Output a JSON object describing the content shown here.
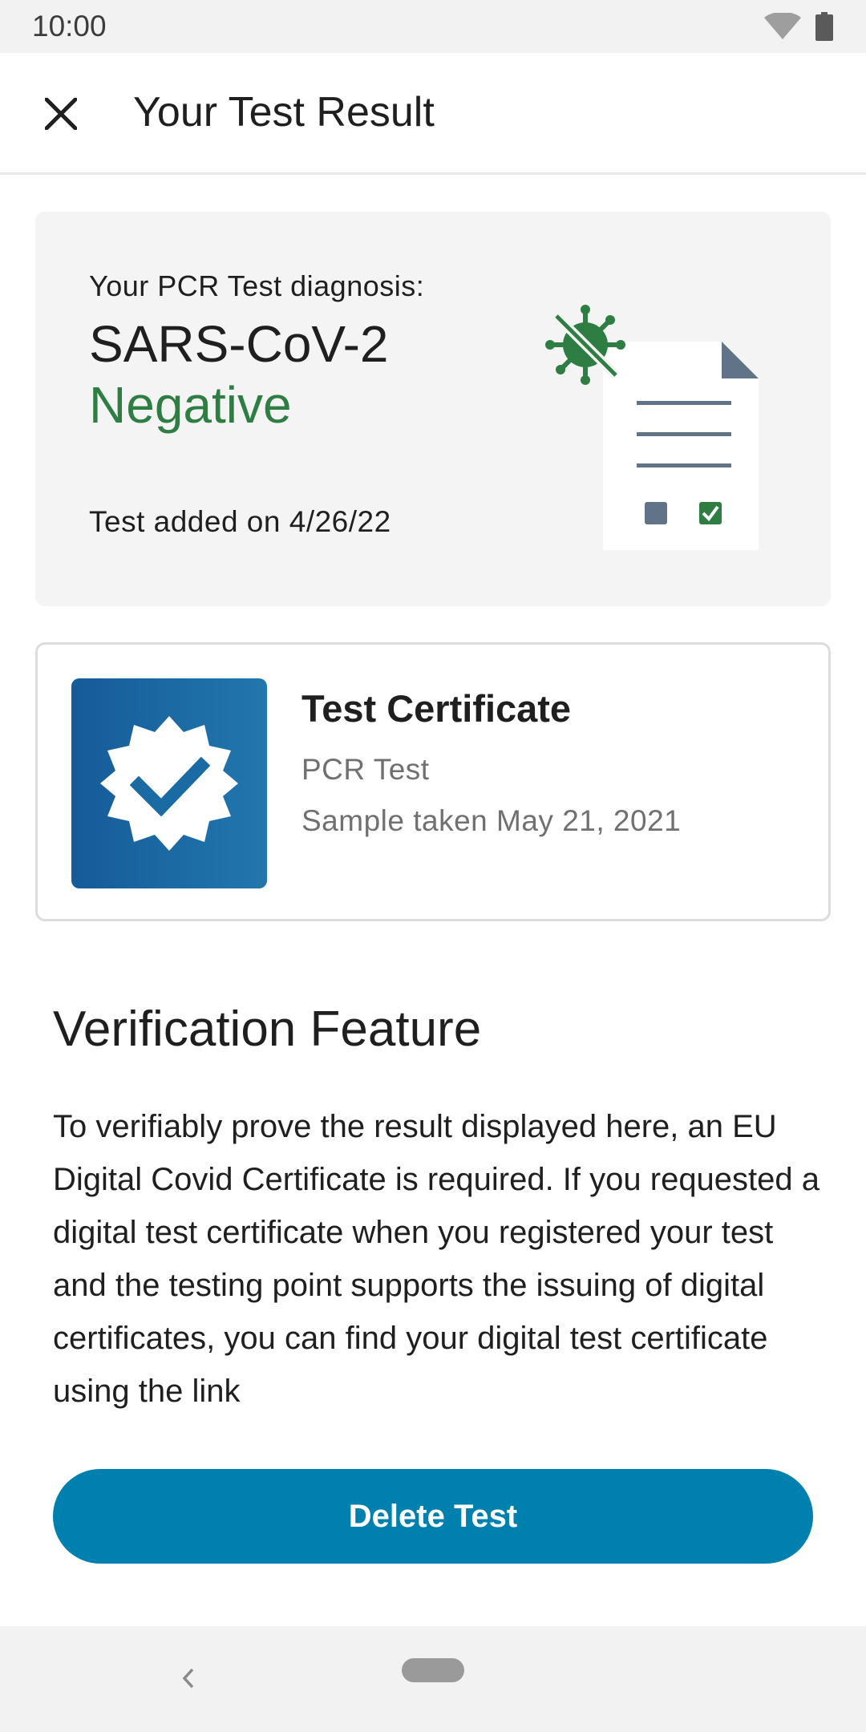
{
  "status_bar": {
    "time": "10:00",
    "icons": [
      "wifi-icon",
      "battery-icon"
    ]
  },
  "app_bar": {
    "title": "Your Test Result",
    "close_icon": "close-icon"
  },
  "result_card": {
    "diagnosis_label": "Your PCR Test diagnosis:",
    "virus": "SARS-CoV-2",
    "result": "Negative",
    "added": "Test added on 4/26/22",
    "illustration_icon": "negative-test-document-icon",
    "result_color": "#2e7d42"
  },
  "certificate": {
    "title": "Test Certificate",
    "type": "PCR Test",
    "sample": "Sample taken May 21, 2021",
    "icon": "verified-badge-icon",
    "badge_color": "#155b99"
  },
  "verification": {
    "title": "Verification Feature",
    "body": "To verifiably prove the result displayed here, an EU Digital Covid Certificate is required. If you requested a digital test certificate when you registered your test and the testing point supports the issuing of digital certificates, you can find your digital test certificate using the link"
  },
  "actions": {
    "delete_label": "Delete Test",
    "accent_color": "#0080ae"
  },
  "nav_bar": {
    "icons": [
      "back-icon",
      "home-pill-icon"
    ]
  }
}
